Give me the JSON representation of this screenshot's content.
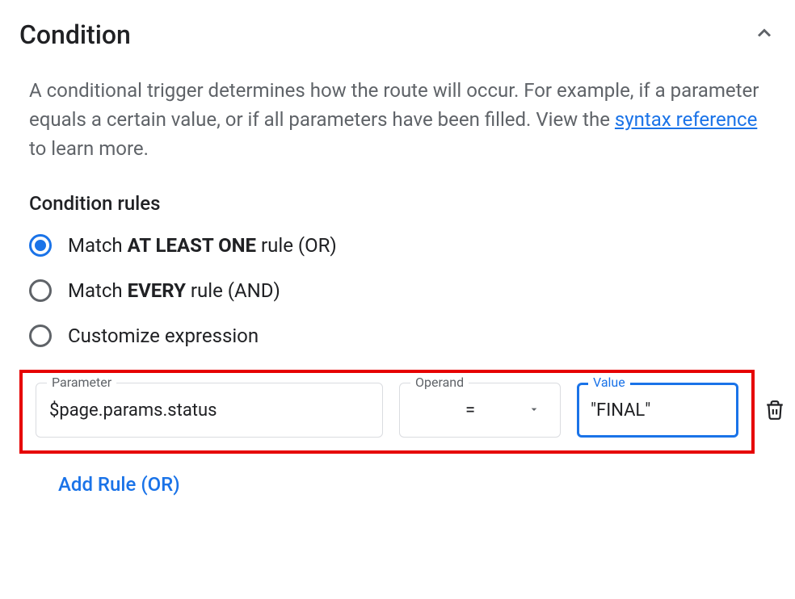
{
  "section": {
    "title": "Condition",
    "description_pre": "A conditional trigger determines how the route will occur. For example, if a parameter equals a certain value, or if all parameters have been filled. View the ",
    "syntax_link": "syntax reference",
    "description_post": " to learn more."
  },
  "rules": {
    "subtitle": "Condition rules",
    "options": [
      {
        "pre": "Match ",
        "bold": "AT LEAST ONE",
        "post": " rule (OR)",
        "selected": true
      },
      {
        "pre": "Match ",
        "bold": "EVERY",
        "post": " rule (AND)",
        "selected": false
      },
      {
        "pre": "Customize expression",
        "bold": "",
        "post": "",
        "selected": false
      }
    ]
  },
  "rule_row": {
    "parameter_label": "Parameter",
    "parameter_value": "$page.params.status",
    "operand_label": "Operand",
    "operand_value": "=",
    "value_label": "Value",
    "value_value": "\"FINAL\""
  },
  "add_rule": "Add Rule (OR)"
}
